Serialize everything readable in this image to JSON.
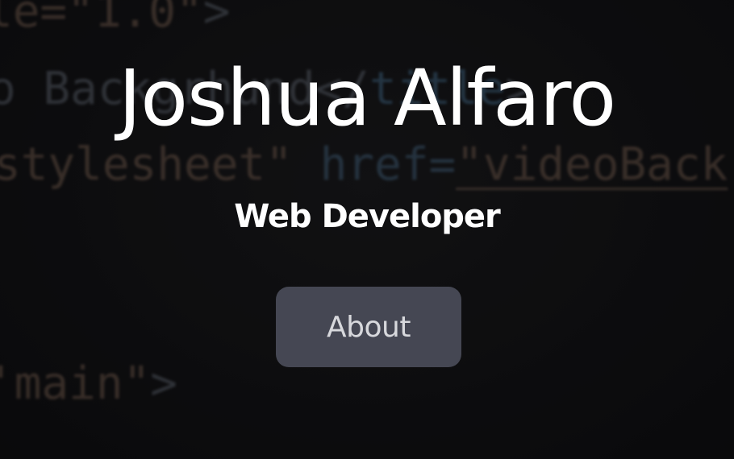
{
  "background": {
    "code_lines": [
      {
        "segments": [
          {
            "cls": "tok-attr",
            "text": "le="
          },
          {
            "cls": "tok-str",
            "text": "\"1.0\""
          },
          {
            "cls": "tok-tag",
            "text": ">"
          }
        ]
      },
      {
        "segments": [
          {
            "cls": "tok-txt",
            "text": "o Backgrhund</"
          },
          {
            "cls": "tok-kw",
            "text": "title"
          },
          {
            "cls": "tok-tag",
            "text": ">"
          }
        ]
      },
      {
        "segments": [
          {
            "cls": "tok-str",
            "text": "stylesheet\" "
          },
          {
            "cls": "tok-href",
            "text": "href="
          },
          {
            "cls": "tok-link",
            "text": "\"videoBack"
          }
        ]
      },
      {
        "segments": [
          {
            "cls": "tok-str",
            "text": "'main\""
          },
          {
            "cls": "tok-tag",
            "text": ">"
          }
        ]
      }
    ]
  },
  "hero": {
    "title": "Joshua Alfaro",
    "subtitle": "Web Developer",
    "about_label": "About"
  },
  "colors": {
    "button_bg": "#454753",
    "text": "#ffffff"
  }
}
